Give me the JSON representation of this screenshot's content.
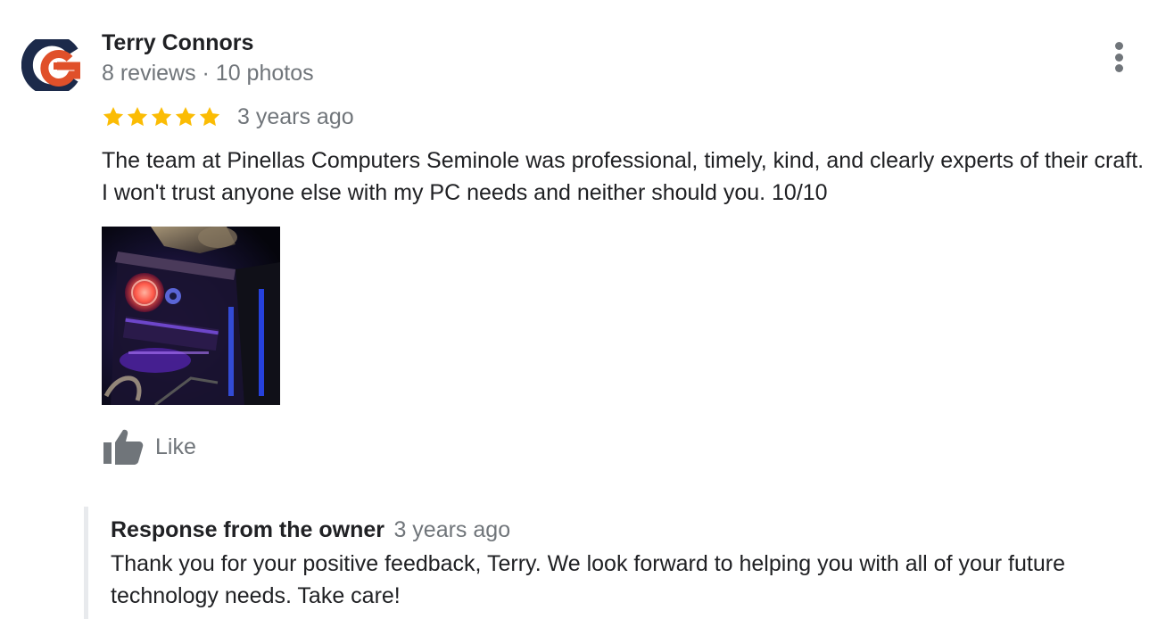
{
  "review": {
    "author": {
      "name": "Terry Connors",
      "meta": "8 reviews · 10 photos",
      "avatar_icon": "company-logo-icon"
    },
    "rating": {
      "stars": 5,
      "max": 5,
      "color": "#fbbc04"
    },
    "date": "3 years ago",
    "text": "The team at Pinellas Computers Seminole was professional, timely, kind, and clearly experts of their craft. I won't trust anyone else with my PC needs and neither should you.  10/10",
    "photo": {
      "icon": "pc-build-photo"
    },
    "like_label": "Like",
    "more_icon": "more-vertical-icon"
  },
  "owner_response": {
    "title": "Response from the owner",
    "date": "3 years ago",
    "text": "Thank you for your positive feedback, Terry. We look forward to helping you with all of your future technology needs. Take care!"
  },
  "colors": {
    "primary_text": "#202124",
    "secondary_text": "#70757a",
    "star": "#fbbc04",
    "avatar_navy": "#1c2a4a",
    "avatar_orange": "#e0502a",
    "response_bar": "#e8eaed"
  }
}
